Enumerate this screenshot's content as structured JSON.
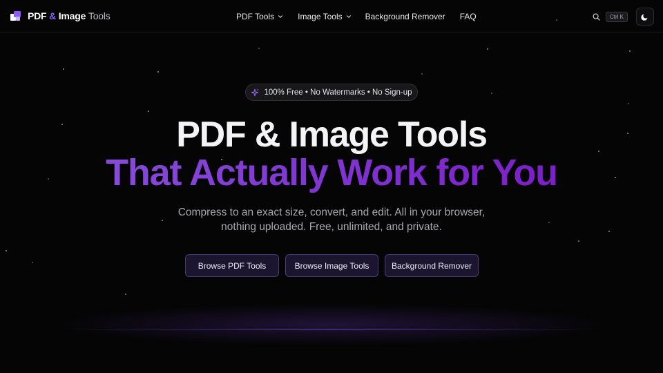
{
  "brand": {
    "part1": "PDF",
    "amp": "&",
    "part2": "Image",
    "part3": "Tools",
    "accent": "#8b5cf6"
  },
  "nav": {
    "items": [
      {
        "label": "PDF Tools",
        "has_dropdown": true
      },
      {
        "label": "Image Tools",
        "has_dropdown": true
      },
      {
        "label": "Background Remover",
        "has_dropdown": false
      },
      {
        "label": "FAQ",
        "has_dropdown": false
      }
    ],
    "search_icon": "search-icon",
    "shortcut": "Ctrl K",
    "theme_icon": "moon-icon"
  },
  "hero": {
    "badge_icon": "sparkles-icon",
    "badge": "100% Free • No Watermarks • No Sign-up",
    "title_line1": "PDF & Image Tools",
    "title_line2": "That Actually Work for You",
    "subtitle_line1": "Compress to an exact size, convert, and edit. All in your browser,",
    "subtitle_line2": "nothing uploaded. Free, unlimited, and private.",
    "buttons": [
      {
        "label": "Browse PDF Tools"
      },
      {
        "label": "Browse Image Tools"
      },
      {
        "label": "Background Remover"
      }
    ]
  },
  "colors": {
    "background": "#050506",
    "gradient_start": "#8a55dc",
    "gradient_end": "#7a14c4",
    "button_border": "#4a3a78"
  }
}
